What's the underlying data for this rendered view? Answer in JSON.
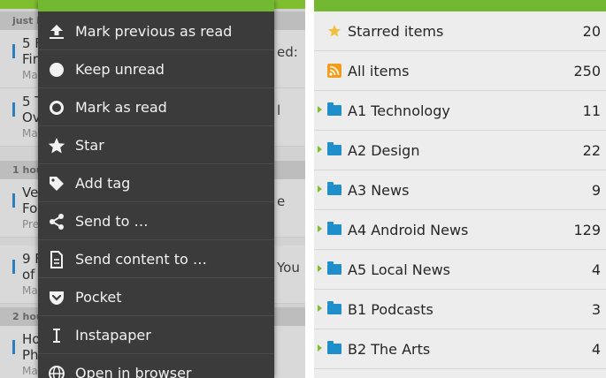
{
  "left_panel": {
    "sections": [
      {
        "label": "just i"
      },
      {
        "label": "1 hou"
      },
      {
        "label": "2 hou"
      }
    ],
    "rows": [
      {
        "title": "5 F",
        "title2": "Fir",
        "meta": "Ma",
        "right": "ed:"
      },
      {
        "title": "5 T",
        "title2": "Ov",
        "meta": "Ma",
        "right": "l"
      },
      {
        "title": "Ve",
        "title2": "Fo",
        "meta": "Pre",
        "right": "e"
      },
      {
        "title": "9 F",
        "title2": "of",
        "meta": "Ma",
        "right": "You"
      },
      {
        "title": "Ho",
        "title2": "Ph",
        "meta": "Ma",
        "right": ""
      }
    ]
  },
  "context_menu": {
    "items": [
      {
        "label": "Mark previous as read",
        "icon": "upload-arrow-icon"
      },
      {
        "label": "Keep unread",
        "icon": "filled-circle-icon"
      },
      {
        "label": "Mark as read",
        "icon": "ring-icon"
      },
      {
        "label": "Star",
        "icon": "star-icon"
      },
      {
        "label": "Add tag",
        "icon": "tag-icon"
      },
      {
        "label": "Send to …",
        "icon": "share-icon"
      },
      {
        "label": "Send content to …",
        "icon": "document-icon"
      },
      {
        "label": "Pocket",
        "icon": "pocket-icon"
      },
      {
        "label": "Instapaper",
        "icon": "instapaper-icon"
      },
      {
        "label": "Open in browser",
        "icon": "globe-icon"
      }
    ]
  },
  "feeds": [
    {
      "label": "Starred items",
      "count": "20",
      "icon": "star-icon"
    },
    {
      "label": "All items",
      "count": "250",
      "icon": "rss-icon"
    },
    {
      "label": "A1 Technology",
      "count": "11",
      "icon": "folder-icon"
    },
    {
      "label": "A2 Design",
      "count": "22",
      "icon": "folder-icon"
    },
    {
      "label": "A3 News",
      "count": "9",
      "icon": "folder-icon"
    },
    {
      "label": "A4 Android News",
      "count": "129",
      "icon": "folder-icon"
    },
    {
      "label": "A5 Local News",
      "count": "4",
      "icon": "folder-icon"
    },
    {
      "label": "B1 Podcasts",
      "count": "3",
      "icon": "folder-icon"
    },
    {
      "label": "B2 The Arts",
      "count": "4",
      "icon": "folder-icon"
    }
  ],
  "colors": {
    "accent": "#72b830",
    "folder": "#1e8fcb",
    "menu_bg": "#3b3b3b",
    "rss": "#f39c1a",
    "star": "#f0c040"
  }
}
